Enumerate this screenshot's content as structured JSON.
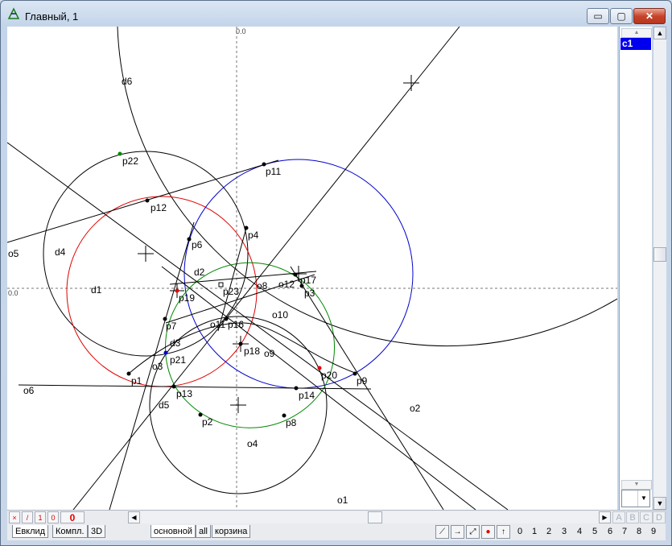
{
  "window": {
    "title": "Главный, 1",
    "min_label": "▭",
    "max_label": "▢",
    "close_label": "✕"
  },
  "canvas": {
    "axis_x_label": "0.0",
    "axis_y_label": "0.0",
    "labels": [
      "d6",
      "p22",
      "p11",
      "p12",
      "p4",
      "p6",
      "o5",
      "d4",
      "d2",
      "p23",
      "o8",
      "o12",
      "p17",
      "p3",
      "d1",
      "p19",
      "o10",
      "p7",
      "o11",
      "p16",
      "d3",
      "p18",
      "o9",
      "o3",
      "p21",
      "p20",
      "p9",
      "p1",
      "p13",
      "p14",
      "o6",
      "d5",
      "o2",
      "p2",
      "p8",
      "o4",
      "o1"
    ]
  },
  "object_list": {
    "items": [
      "c1"
    ]
  },
  "toolbar": {
    "count_value": "0",
    "btn_x": "×",
    "btn_slash": "/",
    "btn_one": "1",
    "btn_zero": "0"
  },
  "letters": [
    "A",
    "B",
    "C",
    "D"
  ],
  "tabs_left": [
    "Евклид",
    "Компл.",
    "3D"
  ],
  "tabs_right": [
    "основной",
    "all",
    "корзина"
  ],
  "digits": [
    "0",
    "1",
    "2",
    "3",
    "4",
    "5",
    "6",
    "7",
    "8",
    "9"
  ],
  "colors": {
    "red": "#e00000",
    "blue": "#0000cc",
    "green": "#008800",
    "selected": "#0000ee"
  }
}
